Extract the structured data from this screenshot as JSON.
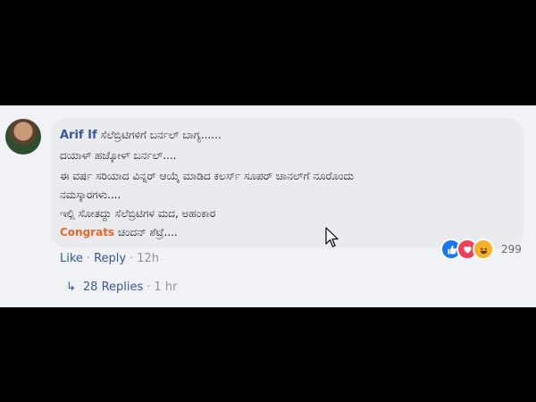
{
  "comment": {
    "author": "Arif If",
    "lines": [
      "ಸೆಲೆಬ್ರಿಟಿಗಳಿಗೆ ಬರ್ನಲ್ ಬಾಗ್ಯ......",
      "ದಯಾಳ್ ಹಚ್ಕೋಳ್ ಬರ್ನಲ್....",
      "ಈ ವರ್ಷ ಸರಿಯಾದ ವಿನ್ನರ್ ಆಯ್ಕೆ ಮಾಡಿದ ಕಲರ್ಸ್ ಸೂಪರ್ ಚಾನಲ್‌ಗೆ ನೂರೊಂದು",
      "ನಮಸ್ಕಾರಗಳು....",
      "ಇಲ್ಲಿ ಸೋತದ್ದು ಸೆಲೆಬ್ರಿಟಿಗಳ ಮದ, ಅಹಂಕಾರ"
    ],
    "last_line_highlight": "Congrats",
    "last_line_rest": "ಚಂದನ್ ಶೆಟ್ರೆ....",
    "reactions_count": "299",
    "reaction_icons": [
      "like-icon",
      "love-icon",
      "haha-icon"
    ]
  },
  "actions": {
    "like": "Like",
    "sep": "·",
    "reply": "Reply",
    "time": "12h"
  },
  "replies": {
    "arrow": "↳",
    "label": "28 Replies",
    "sep": "·",
    "time": "1 hr"
  },
  "colors": {
    "link": "#385898",
    "highlight": "#e86a2b",
    "bubble": "#e9ebee"
  }
}
